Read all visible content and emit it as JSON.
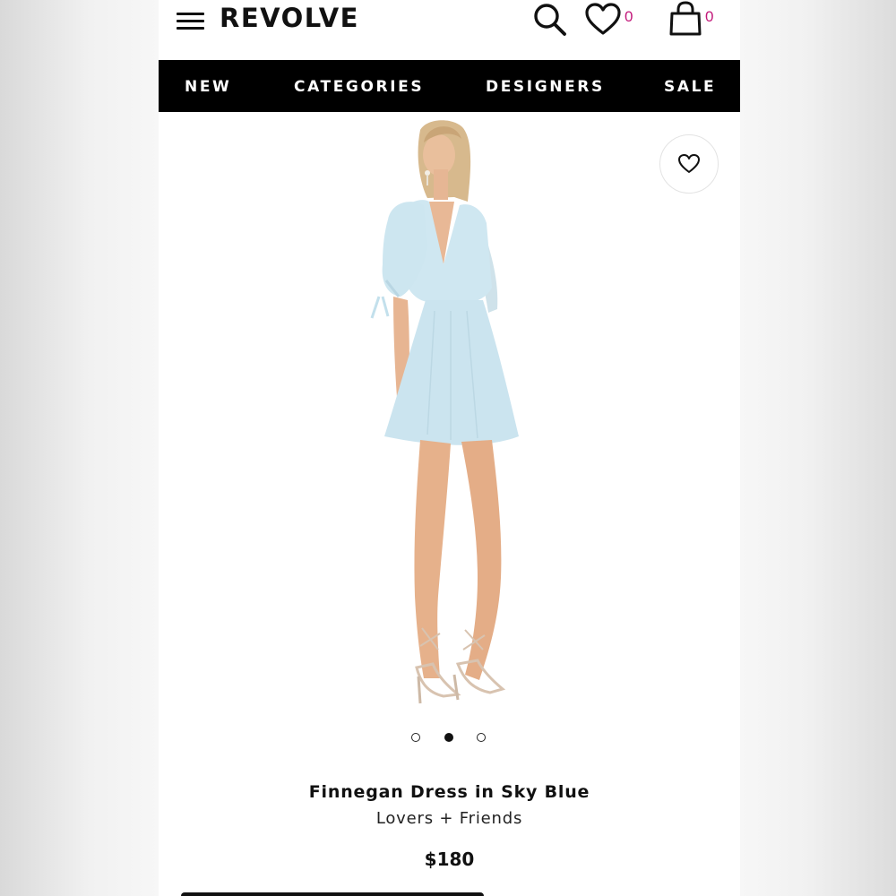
{
  "header": {
    "logo": "REVOLVE",
    "menu_icon": "hamburger-menu-icon",
    "search_icon": "search-icon",
    "wishlist_icon": "heart-icon",
    "wishlist_count": "0",
    "bag_icon": "shopping-bag-icon",
    "bag_count": "0"
  },
  "nav": {
    "items": [
      {
        "label": "NEW"
      },
      {
        "label": "CATEGORIES"
      },
      {
        "label": "DESIGNERS"
      },
      {
        "label": "SALE"
      }
    ]
  },
  "product": {
    "image_icon": "model-wearing-dress-photo",
    "favorite_icon": "heart-outline-icon",
    "carousel": {
      "total": 3,
      "active": 2
    },
    "name": "Finnegan Dress in Sky Blue",
    "brand": "Lovers + Friends",
    "price": "$180"
  },
  "colors": {
    "nav_bg": "#000000",
    "badge": "#c2187a",
    "dress": "#cfe7f1"
  }
}
